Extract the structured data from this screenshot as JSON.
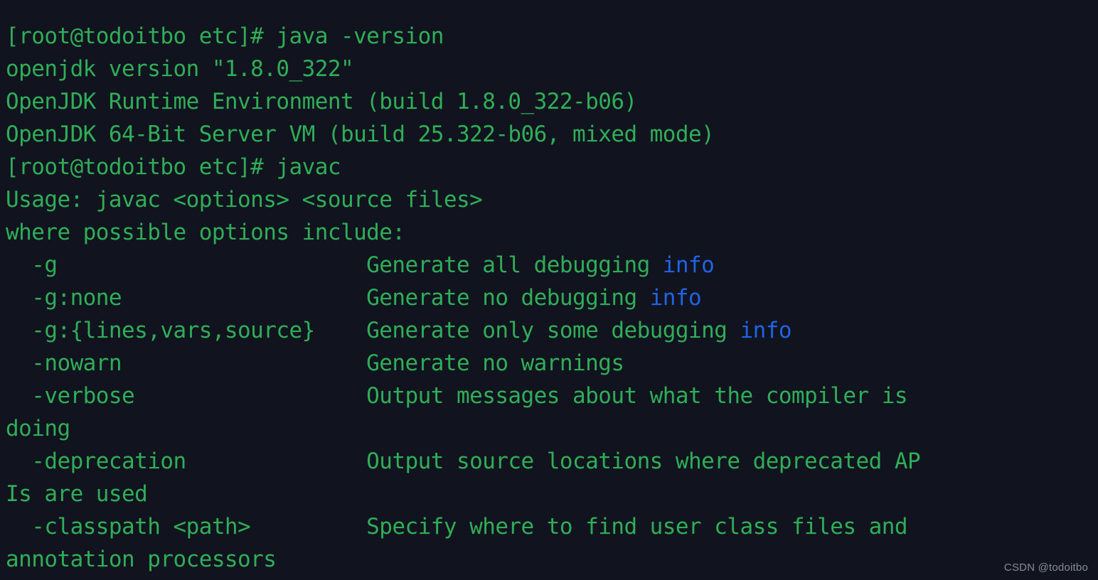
{
  "terminal": {
    "background_color": "#11131f",
    "text_color": "#2fae57",
    "accent_color": "#1f63e6",
    "prompt": "[root@todoitbo etc]#",
    "hostname": "todoitbo",
    "user": "root",
    "cwd": "etc",
    "lines": [
      {
        "id": "line-1",
        "segments": [
          {
            "text": "[root@todoitbo etc]# java -version",
            "color": "green"
          }
        ]
      },
      {
        "id": "line-2",
        "segments": [
          {
            "text": "openjdk version \"1.8.0_322\"",
            "color": "green"
          }
        ]
      },
      {
        "id": "line-3",
        "segments": [
          {
            "text": "OpenJDK Runtime Environment (build 1.8.0_322-b06)",
            "color": "green"
          }
        ]
      },
      {
        "id": "line-4",
        "segments": [
          {
            "text": "OpenJDK 64-Bit Server VM (build 25.322-b06, mixed mode)",
            "color": "green"
          }
        ]
      },
      {
        "id": "line-5",
        "segments": [
          {
            "text": "[root@todoitbo etc]# javac",
            "color": "green"
          }
        ]
      },
      {
        "id": "line-6",
        "segments": [
          {
            "text": "Usage: javac <options> <source files>",
            "color": "green"
          }
        ]
      },
      {
        "id": "line-7",
        "segments": [
          {
            "text": "where possible options include:",
            "color": "green"
          }
        ]
      },
      {
        "id": "line-8",
        "segments": [
          {
            "text": "  -g                        Generate all debugging ",
            "color": "green"
          },
          {
            "text": "info",
            "color": "blue"
          }
        ]
      },
      {
        "id": "line-9",
        "segments": [
          {
            "text": "  -g:none                   Generate no debugging ",
            "color": "green"
          },
          {
            "text": "info",
            "color": "blue"
          }
        ]
      },
      {
        "id": "line-10",
        "segments": [
          {
            "text": "  -g:{lines,vars,source}    Generate only some debugging ",
            "color": "green"
          },
          {
            "text": "info",
            "color": "blue"
          }
        ]
      },
      {
        "id": "line-11",
        "segments": [
          {
            "text": "  -nowarn                   Generate no warnings",
            "color": "green"
          }
        ]
      },
      {
        "id": "line-12",
        "segments": [
          {
            "text": "  -verbose                  Output messages about what the compiler is",
            "color": "green"
          }
        ]
      },
      {
        "id": "line-13",
        "segments": [
          {
            "text": "doing",
            "color": "green"
          }
        ]
      },
      {
        "id": "line-14",
        "segments": [
          {
            "text": "  -deprecation              Output source locations where deprecated AP",
            "color": "green"
          }
        ]
      },
      {
        "id": "line-15",
        "segments": [
          {
            "text": "Is are used",
            "color": "green"
          }
        ]
      },
      {
        "id": "line-16",
        "segments": [
          {
            "text": "  -classpath <path>         Specify where to find user class files and",
            "color": "green"
          }
        ]
      },
      {
        "id": "line-17",
        "segments": [
          {
            "text": "annotation processors",
            "color": "green"
          }
        ]
      }
    ]
  },
  "watermark": {
    "text": "CSDN @todoitbo"
  }
}
